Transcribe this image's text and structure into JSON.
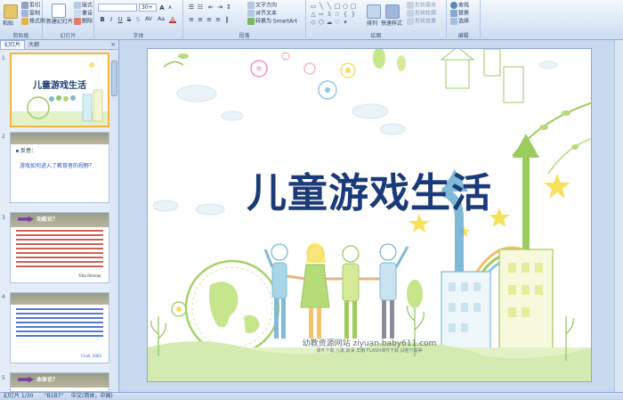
{
  "ribbon": {
    "clipboard": {
      "paste": "粘贴",
      "cut": "剪切",
      "copy": "复制",
      "format_painter": "格式刷",
      "label": "剪贴板"
    },
    "slides": {
      "new_slide": "新建幻灯片",
      "layout": "版式",
      "reset": "重设",
      "delete": "删除",
      "label": "幻灯片"
    },
    "font": {
      "size_value": "30+",
      "grow": "A",
      "shrink": "A",
      "bold": "B",
      "italic": "I",
      "underline": "U",
      "strike": "S",
      "shadow": "S",
      "spacing": "AV",
      "case": "Aa",
      "color": "A",
      "label": "字体"
    },
    "paragraph": {
      "text_direction": "文字方向",
      "align_text": "对齐文本",
      "smartart": "转换为 SmartArt",
      "label": "段落"
    },
    "drawing": {
      "arrange": "排列",
      "quick_styles": "快速样式",
      "shape_fill": "形状填充",
      "shape_outline": "形状轮廓",
      "shape_effects": "形状效果",
      "label": "绘图"
    },
    "editing": {
      "find": "查找",
      "replace": "替换",
      "select": "选择",
      "label": "编辑"
    }
  },
  "pane": {
    "tabs": [
      "幻灯片",
      "大纲"
    ],
    "close": "×",
    "slides": [
      {
        "num": "1",
        "title": "儿童游戏生活"
      },
      {
        "num": "2",
        "heading": "反思：",
        "text": "游戏如何进入了教育者的视野？"
      },
      {
        "num": "3",
        "heading": "功能论？",
        "author": "Fritz Rimmer"
      },
      {
        "num": "4",
        "author": "Ciroll, 2002"
      },
      {
        "num": "5",
        "heading": "本体论？"
      }
    ]
  },
  "slide": {
    "title": "儿童游戏生活",
    "watermark": "幼教资源网站  ziyuan.baby611.com",
    "watermark_sub": "课件下载   儿歌 故事 早教   FLASH课件下载   试卷下载等"
  },
  "status": {
    "slide_counter": "幻灯片 1/30",
    "theme": "\"B1B7\"",
    "language": "中文(简体，中国)"
  },
  "colors": {
    "title": "#1b3a78",
    "ribbon_bg": "#dbe7f6",
    "selection": "#f4b63a"
  }
}
